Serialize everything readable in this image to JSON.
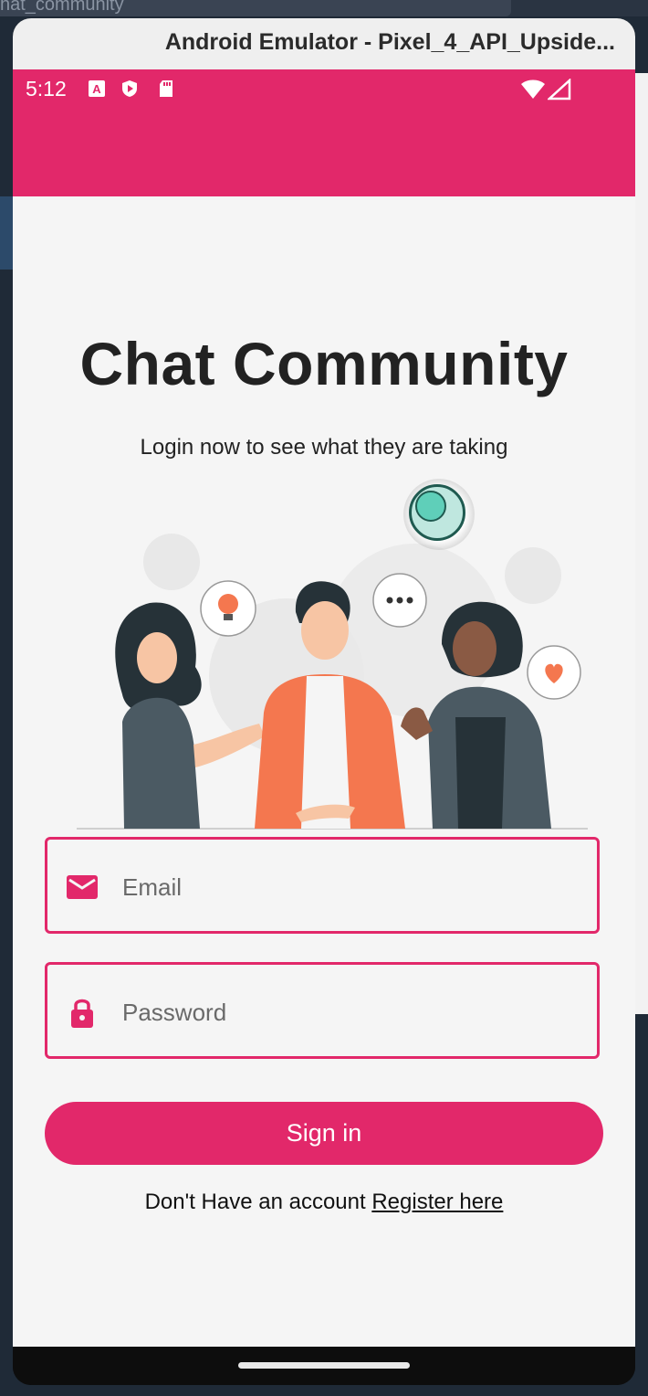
{
  "background": {
    "tab_title": "hat_community"
  },
  "emulator": {
    "window_title": "Android Emulator - Pixel_4_API_Upside..."
  },
  "status_bar": {
    "time": "5:12",
    "icons": [
      "a-notification-icon",
      "shield-play-icon",
      "sd-card-icon",
      "wifi-icon",
      "cell-signal-icon"
    ]
  },
  "colors": {
    "primary": "#e2286a",
    "background": "#f5f5f5"
  },
  "screen": {
    "title": "Chat Community",
    "subtitle": "Login now to see what they are taking"
  },
  "form": {
    "email_placeholder": "Email",
    "password_placeholder": "Password",
    "signin_label": "Sign in",
    "register_prompt": "Don't Have an account ",
    "register_link": "Register here"
  }
}
